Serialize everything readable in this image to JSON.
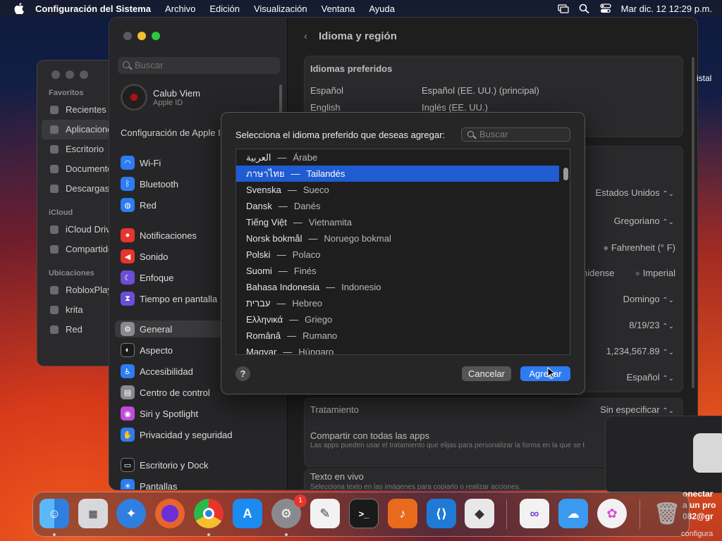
{
  "menubar": {
    "app": "Configuración del Sistema",
    "items": [
      "Archivo",
      "Edición",
      "Visualización",
      "Ventana",
      "Ayuda"
    ],
    "clock": "Mar dic. 12  12:29 p.m."
  },
  "finder": {
    "sections": [
      {
        "title": "Favoritos",
        "items": [
          "Recientes",
          "Aplicaciones",
          "Escritorio",
          "Documentos",
          "Descargas"
        ]
      },
      {
        "title": "iCloud",
        "items": [
          "iCloud Drive",
          "Compartido"
        ]
      },
      {
        "title": "Ubicaciones",
        "items": [
          "RobloxPlayer",
          "krita",
          "Red"
        ]
      }
    ]
  },
  "sidebar": {
    "search_placeholder": "Buscar",
    "user_name": "Calub Viem",
    "user_sub": "Apple ID",
    "header": "Configuración de Apple ID",
    "items": [
      {
        "label": "Wi-Fi",
        "icon": "wifi-icon",
        "color": "#2d7cf1"
      },
      {
        "label": "Bluetooth",
        "icon": "bluetooth-icon",
        "color": "#2d7cf1"
      },
      {
        "label": "Red",
        "icon": "globe-icon",
        "color": "#2d7cf1"
      },
      {
        "label": "Notificaciones",
        "icon": "bell-icon",
        "color": "#e8342c"
      },
      {
        "label": "Sonido",
        "icon": "speaker-icon",
        "color": "#e8342c"
      },
      {
        "label": "Enfoque",
        "icon": "moon-icon",
        "color": "#6a4fd6"
      },
      {
        "label": "Tiempo en pantalla",
        "icon": "hourglass-icon",
        "color": "#6a4fd6"
      },
      {
        "label": "General",
        "icon": "gear-icon",
        "color": "#8a8a8e"
      },
      {
        "label": "Aspecto",
        "icon": "appearance-icon",
        "color": "#1a1a1a"
      },
      {
        "label": "Accesibilidad",
        "icon": "accessibility-icon",
        "color": "#2d7cf1"
      },
      {
        "label": "Centro de control",
        "icon": "control-center-icon",
        "color": "#8a8a8e"
      },
      {
        "label": "Siri y Spotlight",
        "icon": "siri-icon",
        "color": "#c04cd8"
      },
      {
        "label": "Privacidad y seguridad",
        "icon": "hand-icon",
        "color": "#2d7cf1"
      },
      {
        "label": "Escritorio y Dock",
        "icon": "dock-icon",
        "color": "#1a1a1a"
      },
      {
        "label": "Pantallas",
        "icon": "display-icon",
        "color": "#2d7cf1"
      }
    ]
  },
  "main": {
    "title": "Idioma y región",
    "pref_header": "Idiomas preferidos",
    "languages": [
      {
        "name": "Español",
        "detail": "Español (EE. UU.) (principal)"
      },
      {
        "name": "English",
        "detail": "Inglés (EE. UU.)"
      }
    ],
    "values": {
      "region": "Estados Unidos",
      "calendar": "Gregoriano",
      "temperature": "Fahrenheit (° F)",
      "measure_a": "nidense",
      "measure_b": "Imperial",
      "first_day": "Domingo",
      "date_format": "8/19/23",
      "number_format": "1,234,567.89",
      "sort_order": "Español"
    },
    "treatment_label": "Tratamiento",
    "treatment_value": "Sin especificar",
    "share_label": "Compartir con todas las apps",
    "share_sub": "Las apps pueden usar el tratamiento que elijas para personalizar la forma en la que se t",
    "live_text_label": "Texto en vivo",
    "live_text_sub": "Selecciona texto en las imágenes para copiarlo o realizar acciones."
  },
  "dialog": {
    "prompt": "Selecciona el idioma preferido que deseas agregar:",
    "search_placeholder": "Buscar",
    "selected_index": 1,
    "languages": [
      {
        "native": "العربية",
        "translated": "Árabe"
      },
      {
        "native": "ภาษาไทย",
        "translated": "Tailandés"
      },
      {
        "native": "Svenska",
        "translated": "Sueco"
      },
      {
        "native": "Dansk",
        "translated": "Danés"
      },
      {
        "native": "Tiếng Việt",
        "translated": "Vietnamita"
      },
      {
        "native": "Norsk bokmål",
        "translated": "Noruego bokmal"
      },
      {
        "native": "Polski",
        "translated": "Polaco"
      },
      {
        "native": "Suomi",
        "translated": "Finés"
      },
      {
        "native": "Bahasa Indonesia",
        "translated": "Indonesio"
      },
      {
        "native": "עברית",
        "translated": "Hebreo"
      },
      {
        "native": "Ελληνικά",
        "translated": "Griego"
      },
      {
        "native": "Română",
        "translated": "Rumano"
      },
      {
        "native": "Magyar",
        "translated": "Húngaro"
      }
    ],
    "help": "?",
    "cancel": "Cancelar",
    "add": "Agregar"
  },
  "notification": {
    "line1": "onectar",
    "line2": "a un pro",
    "line3": "082@gr",
    "line4": "configura",
    "edge": "istal"
  },
  "dock": {
    "badge": "1",
    "apps": [
      {
        "icon": "finder-icon",
        "color": "#3a8ef0"
      },
      {
        "icon": "launchpad-icon",
        "color": "#d8d8dc"
      },
      {
        "icon": "safari-icon",
        "color": "#2f7fe0"
      },
      {
        "icon": "firefox-icon",
        "color": "#e8642c"
      },
      {
        "icon": "chrome-icon",
        "color": "#f2f2f2"
      },
      {
        "icon": "app-store-icon",
        "color": "#1a8cf0"
      },
      {
        "icon": "system-settings-icon",
        "color": "#8a8a8e"
      },
      {
        "icon": "textedit-icon",
        "color": "#f2f2f2"
      },
      {
        "icon": "terminal-icon",
        "color": "#1a1a1a"
      },
      {
        "icon": "garageband-icon",
        "color": "#e86a1c"
      },
      {
        "icon": "vscode-icon",
        "color": "#1f7ad6"
      },
      {
        "icon": "roblox-icon",
        "color": "#e8e8e8"
      },
      {
        "icon": "visual-studio-icon",
        "color": "#f2f2f2"
      },
      {
        "icon": "weather-icon",
        "color": "#3a9af0"
      },
      {
        "icon": "krita-icon",
        "color": "#f2f2f2"
      },
      {
        "icon": "trash-icon",
        "color": "#8a8a8e"
      }
    ]
  }
}
